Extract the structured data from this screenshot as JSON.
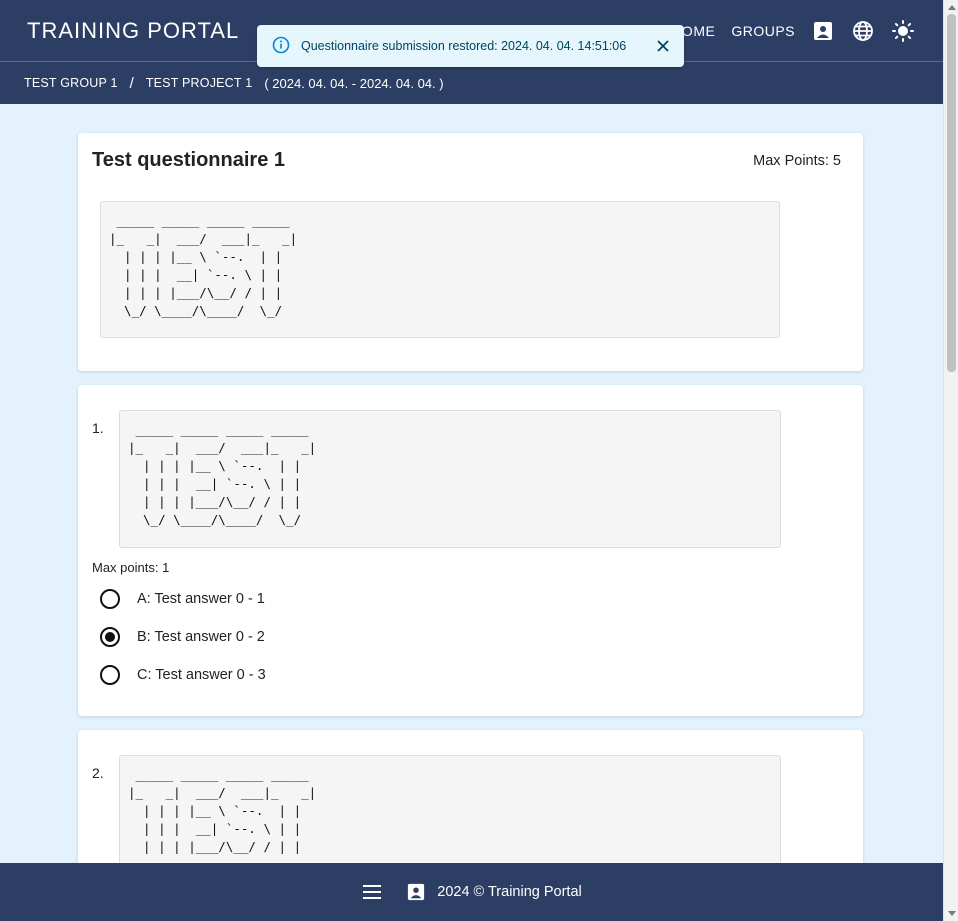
{
  "app": {
    "title": "TRAINING PORTAL"
  },
  "nav": {
    "home": "HOME",
    "groups": "GROUPS",
    "icons": [
      "account-box-icon",
      "globe-icon",
      "sun-icon"
    ]
  },
  "breadcrumb": {
    "group": "TEST GROUP 1",
    "separator": "/",
    "project": "TEST PROJECT 1",
    "date_range": "( 2024. 04. 04. - 2024. 04. 04. )"
  },
  "toast": {
    "message": "Questionnaire submission restored: 2024. 04. 04. 14:51:06",
    "accent": "#0288d1"
  },
  "questionnaire": {
    "title": "Test questionnaire 1",
    "max_points": "Max Points: 5",
    "ascii_art": " _____ _____ _____ _____ \n|_   _|  ___/  ___|_   _|\n  | | | |__ \\ `--.  | |  \n  | | |  __| `--. \\ | |  \n  | | | |___/\\__/ / | |  \n  \\_/ \\____/\\____/  \\_/  "
  },
  "questions": [
    {
      "number": "1.",
      "ascii_art": " _____ _____ _____ _____ \n|_   _|  ___/  ___|_   _|\n  | | | |__ \\ `--.  | |  \n  | | |  __| `--. \\ | |  \n  | | | |___/\\__/ / | |  \n  \\_/ \\____/\\____/  \\_/  ",
      "max_points": "Max points: 1",
      "answers": [
        {
          "label": "A: Test answer 0 - 1",
          "selected": false
        },
        {
          "label": "B: Test answer 0 - 2",
          "selected": true
        },
        {
          "label": "C: Test answer 0 - 3",
          "selected": false
        }
      ]
    },
    {
      "number": "2.",
      "ascii_art": " _____ _____ _____ _____ \n|_   _|  ___/  ___|_   _|\n  | | | |__ \\ `--.  | |  \n  | | |  __| `--. \\ | |  \n  | | | |___/\\__/ / | |  "
    }
  ],
  "footer": {
    "text": "2024 © Training Portal",
    "icons": [
      "menu-icon",
      "account-box-icon"
    ]
  },
  "colors": {
    "primary": "#2c3e64",
    "background": "#e3f2fd",
    "toast_bg": "#e5f6fd"
  }
}
